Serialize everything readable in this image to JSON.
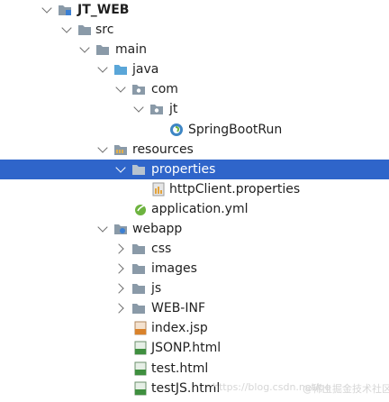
{
  "project_tree": {
    "project_name": "JT_WEB",
    "nodes": {
      "src": "src",
      "main": "main",
      "java": "java",
      "com": "com",
      "jt": "jt",
      "springbootrun": "SpringBootRun",
      "resources": "resources",
      "properties": "properties",
      "httpclient_properties": "httpClient.properties",
      "application_yml": "application.yml",
      "webapp": "webapp",
      "css": "css",
      "images": "images",
      "js": "js",
      "web_inf": "WEB-INF",
      "index_jsp": "index.jsp",
      "jsonp_html": "JSONP.html",
      "test_html": "test.html",
      "testjs_html": "testJS.html"
    },
    "selected": "properties"
  },
  "watermark": {
    "left": "https://blog.csdn.net/qq",
    "right": "@稀土掘金技术社区"
  },
  "colors": {
    "selection": "#2f65ca",
    "folder": "#8a9aa8",
    "source_folder": "#5aa6d8",
    "spring": "#6db33f",
    "html_file": "#3f8f3f",
    "jsp_file": "#d9822b"
  }
}
